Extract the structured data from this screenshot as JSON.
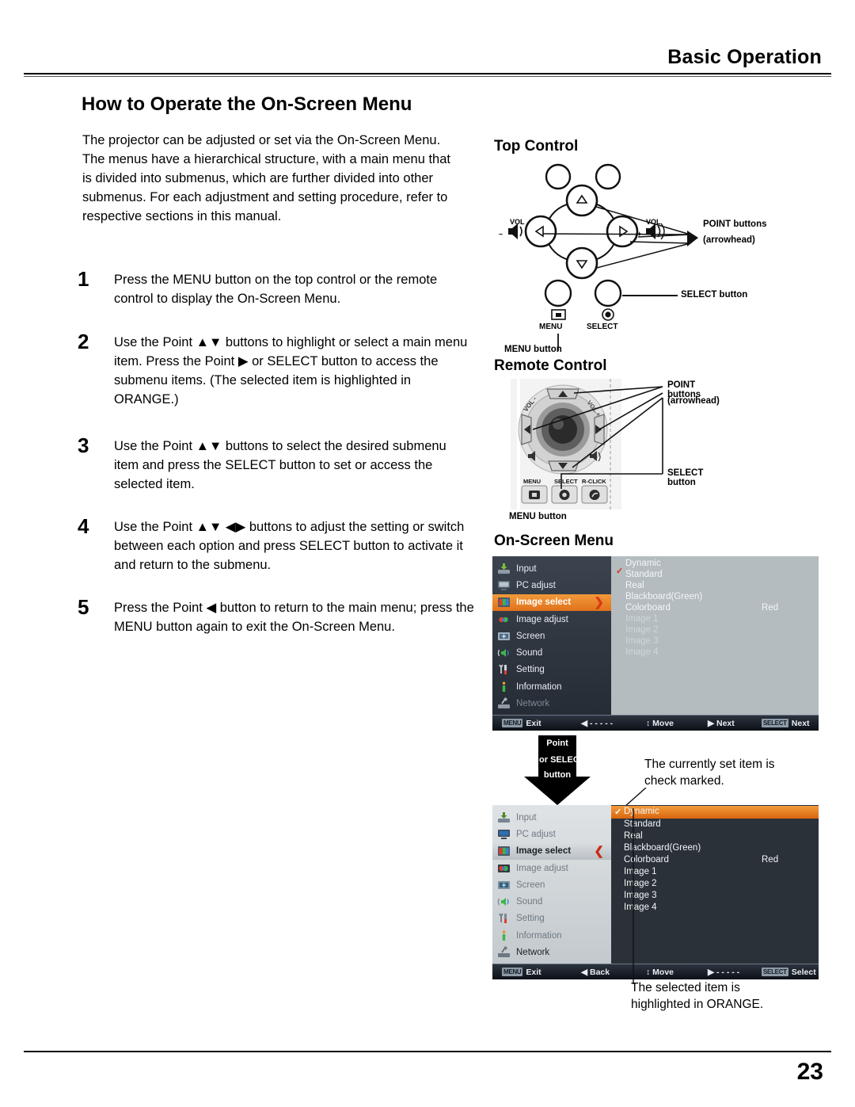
{
  "header": {
    "title": "Basic Operation"
  },
  "footer": {
    "page_number": "23"
  },
  "section": {
    "title": "How to Operate the On-Screen Menu",
    "intro": "The projector can be adjusted or set via the On-Screen Menu. The menus have a hierarchical structure, with a main menu that is divided into submenus, which are further divided into other submenus. For each adjustment and setting procedure, refer to respective sections in this manual."
  },
  "steps": [
    {
      "num": "1",
      "text": "Press the MENU button on the top control or the remote control to display the On-Screen Menu."
    },
    {
      "num": "2",
      "text": "Use the Point ▲▼ buttons to highlight or select a main menu item. Press the Point ▶ or SELECT button to access the submenu items. (The selected item is highlighted in ORANGE.)"
    },
    {
      "num": "3",
      "text": "Use the Point ▲▼ buttons to select the desired submenu item and press the SELECT button to set or access the selected item."
    },
    {
      "num": "4",
      "text": "Use the Point ▲▼ ◀▶ buttons to adjust the setting or switch between each option and press SELECT button to activate it and return to the submenu."
    },
    {
      "num": "5",
      "text": "Press the Point ◀ button to return to the main menu; press the MENU button again to exit the On-Screen Menu."
    }
  ],
  "top_control": {
    "heading": "Top Control",
    "callout_point": "POINT buttons",
    "callout_point2": "(arrowhead)",
    "callout_select": "SELECT button",
    "callout_menu": "MENU button",
    "label_menu": "MENU",
    "label_select": "SELECT",
    "label_vol_minus_1": "VOL",
    "label_vol_minus_2": "–",
    "label_vol_plus_1": "VOL",
    "label_vol_plus_2": "+"
  },
  "remote_control": {
    "heading": "Remote Control",
    "callout_point": "POINT buttons",
    "callout_point2": "(arrowhead)",
    "callout_select": "SELECT button",
    "callout_menu": "MENU button",
    "btn_menu": "MENU",
    "btn_select": "SELECT",
    "btn_rclick": "R-CLICK",
    "label_vol_minus": "VOL -",
    "label_vol_plus": "VOL +"
  },
  "osd": {
    "heading": "On-Screen Menu",
    "sidebar_items": [
      {
        "label": "Input",
        "icon": "input-icon"
      },
      {
        "label": "PC adjust",
        "icon": "pc-adjust-icon"
      },
      {
        "label": "Image select",
        "icon": "image-select-icon"
      },
      {
        "label": "Image adjust",
        "icon": "image-adjust-icon"
      },
      {
        "label": "Screen",
        "icon": "screen-icon"
      },
      {
        "label": "Sound",
        "icon": "sound-icon"
      },
      {
        "label": "Setting",
        "icon": "setting-icon"
      },
      {
        "label": "Information",
        "icon": "information-icon"
      },
      {
        "label": "Network",
        "icon": "network-icon"
      }
    ],
    "options": [
      "Dynamic",
      "Standard",
      "Real",
      "Blackboard(Green)",
      "Colorboard",
      "Image 1",
      "Image 2",
      "Image 3",
      "Image 4"
    ],
    "colorboard_value": "Red",
    "selected_sidebar": "Image select",
    "accent_color": "#e8801f",
    "check_color": "#d03020",
    "menu_a": {
      "checked_option": "Standard",
      "caret": "❯",
      "bar": {
        "exit_key": "MENU",
        "exit_label": "Exit",
        "back_arrow": "◀",
        "back_label": "- - - - -",
        "move_arrow": "↕",
        "move_label": "Move",
        "next_arrow": "▶",
        "next_label": "Next",
        "select_key": "SELECT",
        "select_label": "Next"
      }
    },
    "menu_b": {
      "highlighted_option": "Dynamic",
      "checked_option": "Dynamic",
      "caret": "❮",
      "bar": {
        "exit_key": "MENU",
        "exit_label": "Exit",
        "back_arrow": "◀",
        "back_label": "Back",
        "move_arrow": "↕",
        "move_label": "Move",
        "next_arrow": "▶",
        "next_label": "- - - - -",
        "select_key": "SELECT",
        "select_label": "Select"
      }
    },
    "transition_callout": {
      "line1": "Point",
      "line2": "▶ or SELECT",
      "line3": "button"
    },
    "note_check": "The currently set item is\ncheck marked.",
    "note_check_l1": "The currently set item is",
    "note_check_l2": "check marked.",
    "note_selected_l1": "The selected item is",
    "note_selected_l2": "highlighted in ORANGE."
  }
}
